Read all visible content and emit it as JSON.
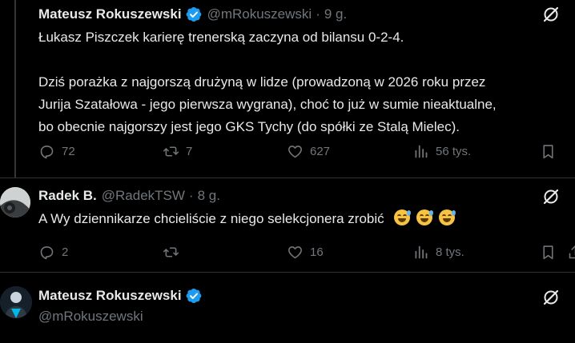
{
  "tweets": [
    {
      "name": "Mateusz Rokuszewski",
      "handle": "@mRokuszewski",
      "time": "9 g.",
      "lines": [
        "Łukasz Piszczek karierę trenerską zaczyna od bilansu 0-2-4.",
        "Dziś porażka z najgorszą drużyną w lidze (prowadzoną w 2026 roku przez",
        "Jurija Szatałowa - jego pierwsza wygrana), choć to już w sumie nieaktualne,",
        "bo obecnie najgorszy jest jego GKS Tychy (do spółki ze Stalą Mielec)."
      ],
      "replies": "72",
      "reposts": "7",
      "likes": "627",
      "views": "56 tys."
    },
    {
      "name": "Radek B.",
      "handle": "@RadekTSW",
      "time": "8 g.",
      "text": "A Wy dziennikarze chcieliście z niego selekcjonera zrobić",
      "emoji": "grinning-face-with-sweat x3",
      "replies": "2",
      "reposts": "",
      "likes": "16",
      "views": "8 tys."
    },
    {
      "name": "Mateusz Rokuszewski",
      "handle": "@mRokuszewski"
    }
  ],
  "dot": "·",
  "colors": {
    "background": "#000000",
    "text": "#e7e9ea",
    "muted": "#71767b",
    "verified": "#1d9bf0"
  }
}
